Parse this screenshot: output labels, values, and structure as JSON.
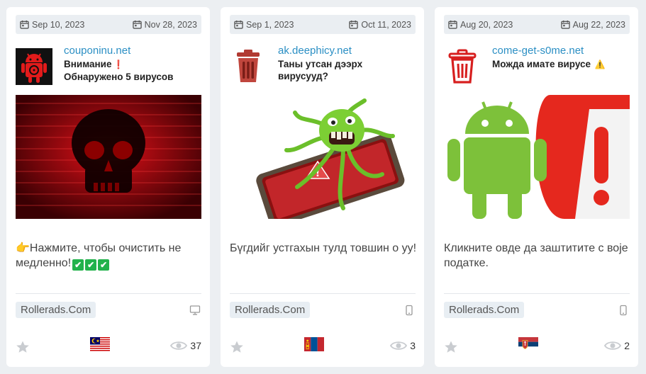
{
  "cards": [
    {
      "first_seen": "Sep 10, 2023",
      "last_seen": "Nov 28, 2023",
      "site": "couponinu.net",
      "title_line1": "Внимание",
      "title_line2": "Обнаружено 5 вирусов",
      "title_emoji": "❗",
      "icon": "android-virus-icon",
      "image": "red-skull-hacker-image",
      "description": "👉Нажмите, чтобы очистить не медленно!",
      "checkmarks": "✔",
      "network": "Rollerads.Com",
      "device": "desktop-icon",
      "flag": "malaysia-flag-icon",
      "views": "37"
    },
    {
      "first_seen": "Sep 1, 2023",
      "last_seen": "Oct 11, 2023",
      "site": "ak.deephicy.net",
      "title_line1": "Таны утсан дээрх",
      "title_line2": "вирусууд?",
      "icon": "trash-bin-icon",
      "image": "green-virus-monster-phone-image",
      "description": "Бүгдийг устгахын тулд товшин о уу!",
      "network": "Rollerads.Com",
      "device": "mobile-icon",
      "flag": "mongolia-flag-icon",
      "views": "3"
    },
    {
      "first_seen": "Aug 20, 2023",
      "last_seen": "Aug 22, 2023",
      "site": "come-get-s0me.net",
      "title_line1": "Можда имате вирусе",
      "title_emoji": "⚠️",
      "icon": "red-trash-bin-icon",
      "image": "android-warning-image",
      "description": "Кликните овде да заштитите с воје податке.",
      "network": "Rollerads.Com",
      "device": "mobile-icon",
      "flag": "serbia-flag-icon",
      "views": "2"
    }
  ],
  "colors": {
    "link": "#2b8fc4",
    "badge_bg": "#e8eef3",
    "check": "#22b24c"
  }
}
